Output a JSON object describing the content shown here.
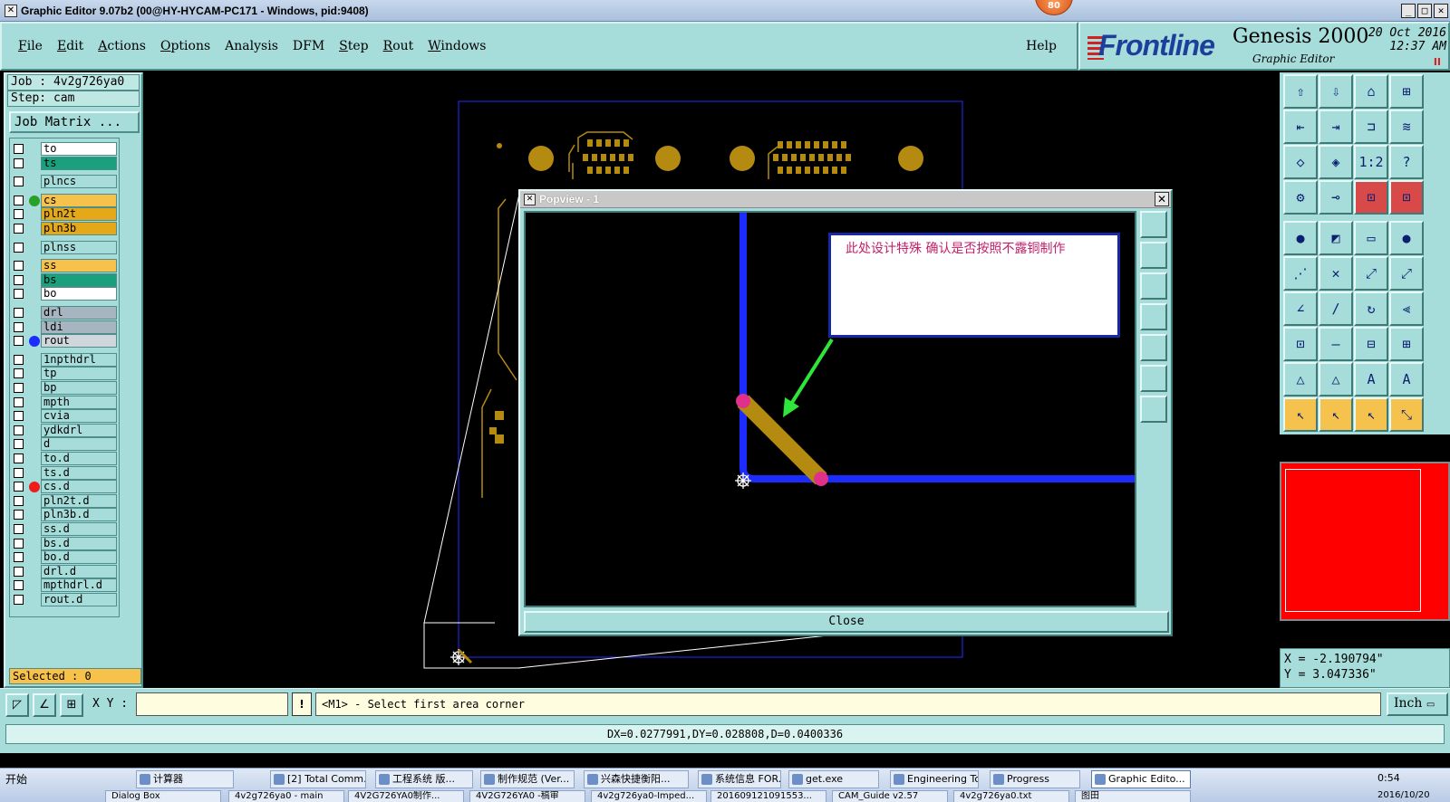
{
  "window": {
    "title": "Graphic Editor 9.07b2 (00@HY-HYCAM-PC171 - Windows, pid:9408)",
    "badge": "80"
  },
  "menu": {
    "items": [
      "File",
      "Edit",
      "Actions",
      "Options",
      "Analysis",
      "DFM",
      "Step",
      "Rout",
      "Windows"
    ],
    "help": "Help"
  },
  "brand": {
    "logo": "Frontline",
    "product": "Genesis 2000",
    "subtitle": "Graphic Editor",
    "date": "20 Oct 2016",
    "time": "12:37 AM",
    "pause": "II"
  },
  "left": {
    "job": "Job : 4v2g726ya0",
    "step": "Step: cam",
    "job_matrix": "Job Matrix ...",
    "selected": "Selected : 0",
    "layers": [
      {
        "name": "to",
        "color": "#ffffff",
        "dot": ""
      },
      {
        "name": "ts",
        "color": "#1aa07c",
        "dot": ""
      },
      {
        "name": "plncs",
        "color": "#a6dcd9",
        "dot": ""
      },
      {
        "name": "cs",
        "color": "#f7c24c",
        "dot": "#2aa02a"
      },
      {
        "name": "pln2t",
        "color": "#e4a818",
        "dot": ""
      },
      {
        "name": "pln3b",
        "color": "#e4a818",
        "dot": ""
      },
      {
        "name": "plnss",
        "color": "#a6dcd9",
        "dot": ""
      },
      {
        "name": "ss",
        "color": "#f7c24c",
        "dot": ""
      },
      {
        "name": "bs",
        "color": "#1aa07c",
        "dot": ""
      },
      {
        "name": "bo",
        "color": "#ffffff",
        "dot": ""
      },
      {
        "name": "drl",
        "color": "#a7b5c0",
        "dot": ""
      },
      {
        "name": "ldi",
        "color": "#a7b5c0",
        "dot": ""
      },
      {
        "name": "rout",
        "color": "#cfd6dc",
        "dot": "#1c2cff"
      },
      {
        "name": "1npthdrl",
        "color": "#a6dcd9",
        "dot": ""
      },
      {
        "name": "tp",
        "color": "#a6dcd9",
        "dot": ""
      },
      {
        "name": "bp",
        "color": "#a6dcd9",
        "dot": ""
      },
      {
        "name": "mpth",
        "color": "#a6dcd9",
        "dot": ""
      },
      {
        "name": "cvia",
        "color": "#a6dcd9",
        "dot": ""
      },
      {
        "name": "ydkdrl",
        "color": "#a6dcd9",
        "dot": ""
      },
      {
        "name": "d",
        "color": "#a6dcd9",
        "dot": ""
      },
      {
        "name": "to.d",
        "color": "#a6dcd9",
        "dot": ""
      },
      {
        "name": "ts.d",
        "color": "#a6dcd9",
        "dot": ""
      },
      {
        "name": "cs.d",
        "color": "#a6dcd9",
        "dot": "#ee1c1c"
      },
      {
        "name": "pln2t.d",
        "color": "#a6dcd9",
        "dot": ""
      },
      {
        "name": "pln3b.d",
        "color": "#a6dcd9",
        "dot": ""
      },
      {
        "name": "ss.d",
        "color": "#a6dcd9",
        "dot": ""
      },
      {
        "name": "bs.d",
        "color": "#a6dcd9",
        "dot": ""
      },
      {
        "name": "bo.d",
        "color": "#a6dcd9",
        "dot": ""
      },
      {
        "name": "drl.d",
        "color": "#a6dcd9",
        "dot": ""
      },
      {
        "name": "mpthdrl.d",
        "color": "#a6dcd9",
        "dot": ""
      },
      {
        "name": "rout.d",
        "color": "#a6dcd9",
        "dot": ""
      }
    ]
  },
  "popview": {
    "title": "Popview - 1",
    "note": "此处设计特殊   确认是否按照不露铜制作",
    "close": "Close"
  },
  "toolbar_glyphs": [
    "⇧",
    "⇩",
    "⌂",
    "⊞",
    "⇤",
    "⇥",
    "⊐",
    "≋",
    "◇",
    "◈",
    "1:2",
    "?",
    "⚙",
    "⊸",
    "⊡",
    "⊡",
    "●",
    "◩",
    "▭",
    "●",
    "⋰",
    "✕",
    "⤢",
    "⤢",
    "∠",
    "∕",
    "↻",
    "⫷",
    "⊡",
    "—",
    "⊟",
    "⊞",
    "△",
    "△",
    "A",
    "A",
    "↖",
    "↖",
    "↖",
    "⤡"
  ],
  "coords": {
    "x": "X = -2.190794\"",
    "y": "Y = 3.047336\""
  },
  "command": {
    "xy_label": "X Y :",
    "prompt": "<M1> - Select first area corner",
    "unit": "Inch",
    "measure": "DX=0.0277991,DY=0.028808,D=0.0400336"
  },
  "taskbar": {
    "start": "开始",
    "tasks": [
      "计算器",
      "[2] Total Comm...",
      "工程系统  版...",
      "制作规范 (Ver...",
      "兴森快捷衡阳...",
      "系统信息 FOR...",
      "get.exe",
      "Engineering To...",
      "Progress",
      "Graphic Edito..."
    ],
    "row2": [
      "Dialog Box",
      "4v2g726ya0 - main",
      "4V2G726YA0制作...",
      "4V2G726YA0 -稿审",
      "4v2g726ya0-Imped...",
      "201609121091553...",
      "CAM_Guide v2.57",
      "4v2g726ya0.txt",
      "图田"
    ],
    "time": "0:54",
    "date": "2016/10/20"
  }
}
